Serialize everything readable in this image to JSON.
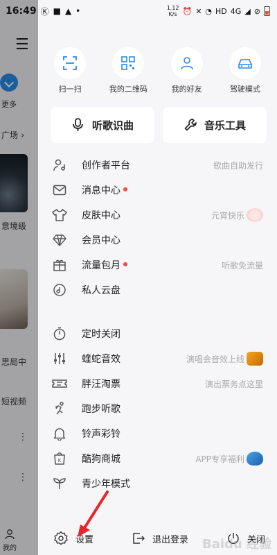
{
  "status_bar": {
    "time": "16:49",
    "speed_value": "1.12",
    "speed_unit": "K/s",
    "network": "HD",
    "signal": "4G"
  },
  "background": {
    "more_label": "更多",
    "square_label": "广场",
    "caption1": "意境级",
    "caption2": "思局中",
    "video_label": "短视频",
    "mine_label": "我的"
  },
  "quick_actions": [
    {
      "label": "扫一扫",
      "icon": "scan-icon"
    },
    {
      "label": "我的二维码",
      "icon": "qr-code-icon"
    },
    {
      "label": "我的好友",
      "icon": "friend-icon"
    },
    {
      "label": "驾驶模式",
      "icon": "car-icon"
    }
  ],
  "big_buttons": [
    {
      "label": "听歌识曲",
      "icon": "mic-icon"
    },
    {
      "label": "音乐工具",
      "icon": "wrench-icon"
    }
  ],
  "menu": [
    {
      "label": "创作者平台",
      "sub": "歌曲自助发行",
      "dot": false,
      "icon": "creator-icon"
    },
    {
      "label": "消息中心",
      "sub": "",
      "dot": true,
      "icon": "message-icon"
    },
    {
      "label": "皮肤中心",
      "sub": "元宵快乐",
      "dot": false,
      "icon": "shirt-icon"
    },
    {
      "label": "会员中心",
      "sub": "",
      "dot": false,
      "icon": "diamond-icon"
    },
    {
      "label": "流量包月",
      "sub": "听歌免流量",
      "dot": true,
      "icon": "gift-icon"
    },
    {
      "label": "私人云盘",
      "sub": "",
      "dot": false,
      "icon": "cloud-disk-icon"
    },
    {
      "label": "定时关闭",
      "sub": "",
      "dot": false,
      "icon": "timer-icon"
    },
    {
      "label": "蝰蛇音效",
      "sub": "演唱会音效上线",
      "dot": false,
      "icon": "equalizer-icon"
    },
    {
      "label": "胖汪淘票",
      "sub": "演出票务点这里",
      "dot": false,
      "icon": "ticket-icon"
    },
    {
      "label": "跑步听歌",
      "sub": "",
      "dot": false,
      "icon": "running-icon"
    },
    {
      "label": "铃声彩铃",
      "sub": "",
      "dot": false,
      "icon": "bell-icon"
    },
    {
      "label": "酷狗商城",
      "sub": "APP专享福利",
      "dot": false,
      "icon": "shop-icon"
    },
    {
      "label": "青少年模式",
      "sub": "",
      "dot": false,
      "icon": "sprout-icon"
    }
  ],
  "bottom": {
    "settings": "设置",
    "logout": "退出登录",
    "close": "关闭"
  },
  "watermark": "Baidu 经验",
  "colors": {
    "accent_blue": "#2a8ae8",
    "red_dot": "#f24c4c",
    "arrow": "#e8262a"
  }
}
